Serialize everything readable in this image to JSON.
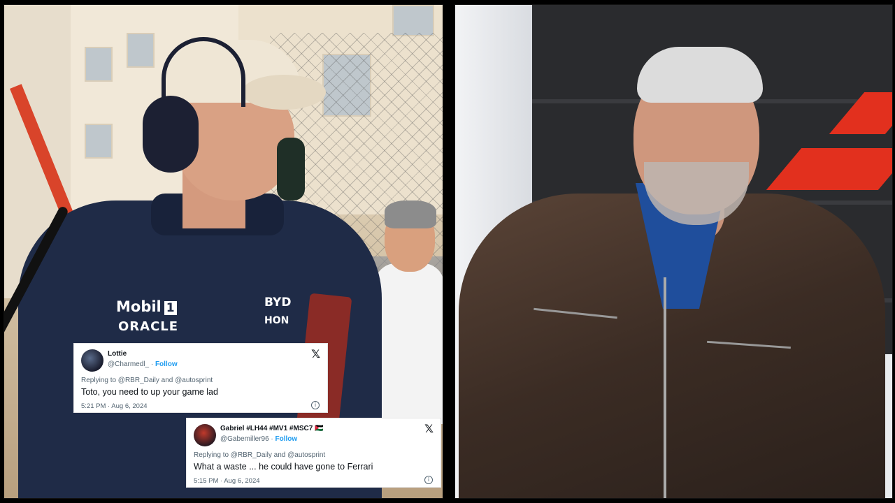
{
  "tweets": [
    {
      "name": "Lottie",
      "handle": "@Charmedl_",
      "follow_label": "Follow",
      "x_icon": "x-logo-icon",
      "reply_line": "Replying to @RBR_Daily and @autosprint",
      "text": "Toto, you need to up your game lad",
      "timestamp": "5:21 PM · Aug 6, 2024"
    },
    {
      "name": "Gabriel #LH44 #MV1 #MSC7 🇯🇴",
      "handle": "@Gabemiller96",
      "follow_label": "Follow",
      "x_icon": "x-logo-icon",
      "reply_line": "Replying to @RBR_Daily and @autosprint",
      "text": "What a waste ... he could have gone to Ferrari",
      "timestamp": "5:15 PM · Aug 6, 2024"
    }
  ],
  "sponsors": {
    "mobil": "Mobil",
    "mobil_one": "1",
    "oracle": "ORACLE",
    "byd": "BYD",
    "hon": "HON"
  },
  "colors": {
    "team_navy": "#1f2b47",
    "jacket_brown": "#3b2c24",
    "f1_red": "#e2301e",
    "link_blue": "#1d9bf0"
  }
}
